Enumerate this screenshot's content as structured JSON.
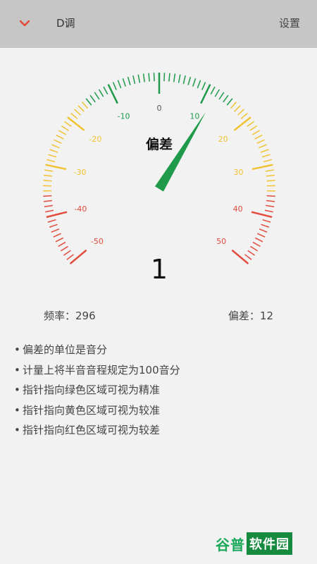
{
  "header": {
    "back_icon": "chevron-down-icon",
    "title": "D调",
    "settings_label": "设置"
  },
  "colors": {
    "header_bg": "#c6c6c6",
    "green": "#1e9a4a",
    "yellow": "#f1c232",
    "red": "#e24a3b",
    "back_icon": "#e24a3b"
  },
  "gauge": {
    "center_label": "偏差",
    "needle_value": 12,
    "reading": "1",
    "ticks": [
      "-50",
      "-40",
      "-30",
      "-20",
      "-10",
      "0",
      "10",
      "20",
      "30",
      "40",
      "50"
    ]
  },
  "stats": {
    "frequency_label": "频率：296",
    "deviation_label": "偏差：12"
  },
  "notes": [
    "偏差的单位是音分",
    "计量上将半音音程规定为100音分",
    "指针指向绿色区域可视为精准",
    "指针指向黄色区域可视为较准",
    "指针指向红色区域可视为较差"
  ],
  "watermark": {
    "left_text": "谷普",
    "box_text": "软件园"
  }
}
